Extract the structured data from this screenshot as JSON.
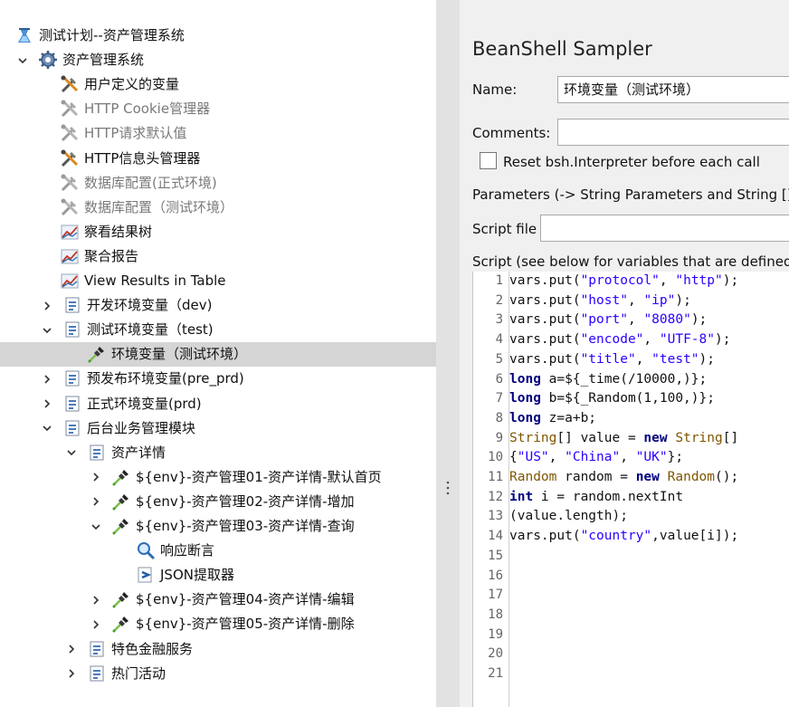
{
  "tree": {
    "items": [
      {
        "label": "测试计划--资产管理系统",
        "expander": "",
        "icon": "test-plan-icon",
        "dim": false
      },
      {
        "label": "资产管理系统",
        "expander": "v",
        "icon": "thread-group-gear-icon",
        "dim": false
      },
      {
        "label": "用户定义的变量",
        "expander": "",
        "icon": "config-tools-icon",
        "dim": false
      },
      {
        "label": "HTTP Cookie管理器",
        "expander": "",
        "icon": "config-tools-disabled-icon",
        "dim": true
      },
      {
        "label": "HTTP请求默认值",
        "expander": "",
        "icon": "config-tools-disabled-icon",
        "dim": true
      },
      {
        "label": "HTTP信息头管理器",
        "expander": "",
        "icon": "config-tools-icon",
        "dim": false
      },
      {
        "label": "数据库配置(正式环境)",
        "expander": "",
        "icon": "config-tools-disabled-icon",
        "dim": true
      },
      {
        "label": "数据库配置（测试环境）",
        "expander": "",
        "icon": "config-tools-disabled-icon",
        "dim": true
      },
      {
        "label": "察看结果树",
        "expander": "",
        "icon": "listener-chart-icon",
        "dim": false
      },
      {
        "label": "聚合报告",
        "expander": "",
        "icon": "listener-chart-icon",
        "dim": false
      },
      {
        "label": "View Results in Table",
        "expander": "",
        "icon": "listener-chart-icon",
        "dim": false
      },
      {
        "label": "开发环境变量（dev)",
        "expander": ">",
        "icon": "controller-icon",
        "dim": false
      },
      {
        "label": "测试环境变量（test)",
        "expander": "v",
        "icon": "controller-icon",
        "dim": false
      },
      {
        "label": "环境变量（测试环境）",
        "expander": "",
        "icon": "sampler-pipette-icon",
        "dim": false
      },
      {
        "label": "预发布环境变量(pre_prd)",
        "expander": ">",
        "icon": "controller-icon",
        "dim": false
      },
      {
        "label": "正式环境变量(prd)",
        "expander": ">",
        "icon": "controller-icon",
        "dim": false
      },
      {
        "label": "后台业务管理模块",
        "expander": "v",
        "icon": "controller-icon",
        "dim": false
      },
      {
        "label": "资产详情",
        "expander": "v",
        "icon": "controller-icon",
        "dim": false
      },
      {
        "label": "${env}-资产管理01-资产详情-默认首页",
        "expander": ">",
        "icon": "sampler-pipette-icon",
        "dim": false
      },
      {
        "label": "${env}-资产管理02-资产详情-增加",
        "expander": ">",
        "icon": "sampler-pipette-icon",
        "dim": false
      },
      {
        "label": "${env}-资产管理03-资产详情-查询",
        "expander": "v",
        "icon": "sampler-pipette-icon",
        "dim": false
      },
      {
        "label": "响应断言",
        "expander": "",
        "icon": "assertion-magnifier-icon",
        "dim": false
      },
      {
        "label": "JSON提取器",
        "expander": "",
        "icon": "post-processor-arrow-icon",
        "dim": false
      },
      {
        "label": "${env}-资产管理04-资产详情-编辑",
        "expander": ">",
        "icon": "sampler-pipette-icon",
        "dim": false
      },
      {
        "label": "${env}-资产管理05-资产详情-删除",
        "expander": ">",
        "icon": "sampler-pipette-icon",
        "dim": false
      },
      {
        "label": "特色金融服务",
        "expander": ">",
        "icon": "controller-icon",
        "dim": false
      },
      {
        "label": "热门活动",
        "expander": ">",
        "icon": "controller-icon",
        "dim": false
      }
    ]
  },
  "panel": {
    "title": "BeanShell Sampler",
    "name_label": "Name:",
    "name_value": "环境变量（测试环境）",
    "comments_label": "Comments:",
    "comments_value": "",
    "reset_label": "Reset bsh.Interpreter before each call",
    "reset_checked": false,
    "parameters_label": "Parameters (-> String Parameters and String []b",
    "script_file_label": "Script file",
    "script_file_value": "",
    "script_label": "Script (see below for variables that are defined)"
  },
  "script": {
    "line_numbers": [
      "1",
      "2",
      "3",
      "4",
      "5",
      "6",
      "7",
      "8",
      "9",
      "10",
      "11",
      "12",
      "13",
      "14",
      "15",
      "16",
      "17",
      "18",
      "19",
      "20",
      "21"
    ],
    "lines": [
      "vars.put(\"protocol\", \"http\");",
      "vars.put(\"host\", \"ip\");",
      "vars.put(\"port\", \"8080\");",
      "vars.put(\"encode\", \"UTF-8\");",
      "vars.put(\"title\", \"test\");",
      "long a=${_time(/10000,)};",
      "long b=${_Random(1,100,)};",
      "long z=a+b;",
      "String[] value = new String[]",
      "{\"US\", \"China\", \"UK\"};",
      "Random random = new Random();",
      "int i = random.nextInt",
      "(value.length);",
      "vars.put(\"country\",value[i]);",
      "",
      "",
      "",
      "",
      "",
      "",
      ""
    ]
  },
  "colors": {
    "selection": "#d5d5d5",
    "keyword": "#00007f",
    "string": "#2a00ff",
    "type": "#7f5500"
  }
}
